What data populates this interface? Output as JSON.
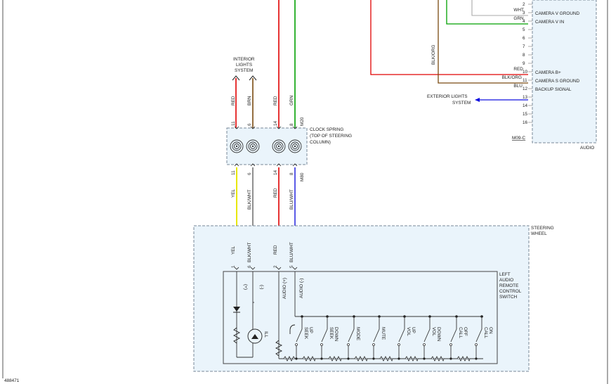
{
  "figure_id": "488471",
  "audio_module": {
    "label": "AUDIO",
    "connector": "M09-C",
    "pins": [
      {
        "num": "2",
        "wire": "",
        "name": ""
      },
      {
        "num": "3",
        "wire": "WHT",
        "name": "CAMERA V GROUND"
      },
      {
        "num": "4",
        "wire": "GRN",
        "name": "CAMERA V IN"
      },
      {
        "num": "5",
        "wire": "",
        "name": ""
      },
      {
        "num": "6",
        "wire": "",
        "name": ""
      },
      {
        "num": "7",
        "wire": "",
        "name": ""
      },
      {
        "num": "8",
        "wire": "",
        "name": ""
      },
      {
        "num": "9",
        "wire": "",
        "name": ""
      },
      {
        "num": "10",
        "wire": "RED",
        "name": "CAMERA B+"
      },
      {
        "num": "11",
        "wire": "BLK/ORG",
        "name": "CAMERA S GROUND"
      },
      {
        "num": "12",
        "wire": "BLU",
        "name": "BACKUP SIGNAL"
      },
      {
        "num": "13",
        "wire": "",
        "name": ""
      },
      {
        "num": "14",
        "wire": "",
        "name": ""
      },
      {
        "num": "15",
        "wire": "",
        "name": ""
      },
      {
        "num": "16",
        "wire": "",
        "name": ""
      }
    ]
  },
  "blk_org_vertical": "BLK/ORG",
  "exterior_lights": [
    "EXTERIOR LIGHTS",
    "SYSTEM"
  ],
  "interior_lights": [
    "INTERIOR",
    "LIGHTS",
    "SYSTEM"
  ],
  "clock_spring": {
    "label": [
      "CLOCK SPRING",
      "(TOP OF STEERING",
      "COLUMN)"
    ],
    "connector_top": "M20",
    "connector_bottom": "M80",
    "top_pins": [
      "11",
      "6",
      "14",
      "8"
    ],
    "top_wires": [
      "RED",
      "BRN",
      "RED",
      "GRN"
    ],
    "bottom_pins": [
      "11",
      "6",
      "14",
      "8"
    ],
    "bottom_wires": [
      "YEL",
      "BLK/WHT",
      "RED",
      "BLU/WHT"
    ]
  },
  "steering_wheel": {
    "label": [
      "STEERING",
      "WHEEL"
    ],
    "wires": [
      "YEL",
      "BLK/WHT",
      "RED",
      "BLU/WHT"
    ],
    "pins": [
      "1",
      "6",
      "2",
      "5"
    ]
  },
  "switch": {
    "label": [
      "LEFT",
      "AUDIO",
      "REMOTE",
      "CONTROL",
      "SWITCH"
    ],
    "plus": "(+)",
    "minus": "(-)",
    "audio_plus": "AUDIO (+)",
    "audio_minus": "AUDIO (-)",
    "ill": "ILL",
    "buttons": [
      "SEEK UP",
      "SEEK DOWN",
      "MODE",
      "MUTE",
      "VOL UP",
      "VOL DOWN",
      "CALL OFF",
      "CALL ON"
    ]
  },
  "colors": {
    "red": "#e00000",
    "green": "#00a000",
    "blue": "#1010e0",
    "yellow": "#e8e800",
    "brown": "#7a4a10",
    "purple": "#6a5acd",
    "box_fill": "#eaf4fb",
    "box_border": "#7a8a99"
  }
}
